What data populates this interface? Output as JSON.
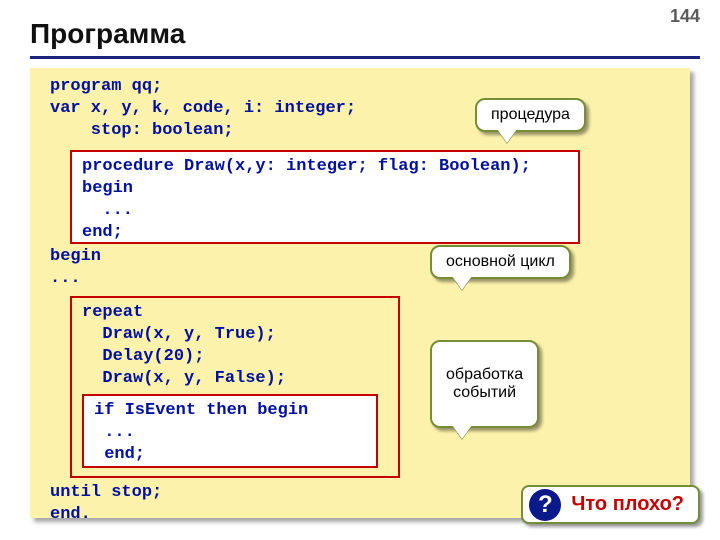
{
  "page_number": "144",
  "title": "Программа",
  "code": {
    "line1": "program qq;",
    "line2": "var x, y, k, code, i: integer;",
    "line3": "    stop: boolean;",
    "proc": {
      "l1": "procedure Draw(x,y: integer; flag: Boolean);",
      "l2": "begin",
      "l3": "  ...",
      "l4": "end;"
    },
    "line_begin": "begin",
    "line_dots": "...",
    "repeat_block": {
      "l1": "repeat",
      "l2": "  Draw(x, y, True);",
      "l3": "  Delay(20);",
      "l4": "  Draw(x, y, False);",
      "event": {
        "l1": "if IsEvent then begin",
        "l2": " ...",
        "l3": " end;"
      }
    },
    "line_until": "until stop;",
    "line_end": "end."
  },
  "callouts": {
    "procedure": "процедура",
    "main_loop": "основной цикл",
    "event_handling": "обработка\nсобытий"
  },
  "question": {
    "icon": "?",
    "text": "Что плохо?"
  }
}
